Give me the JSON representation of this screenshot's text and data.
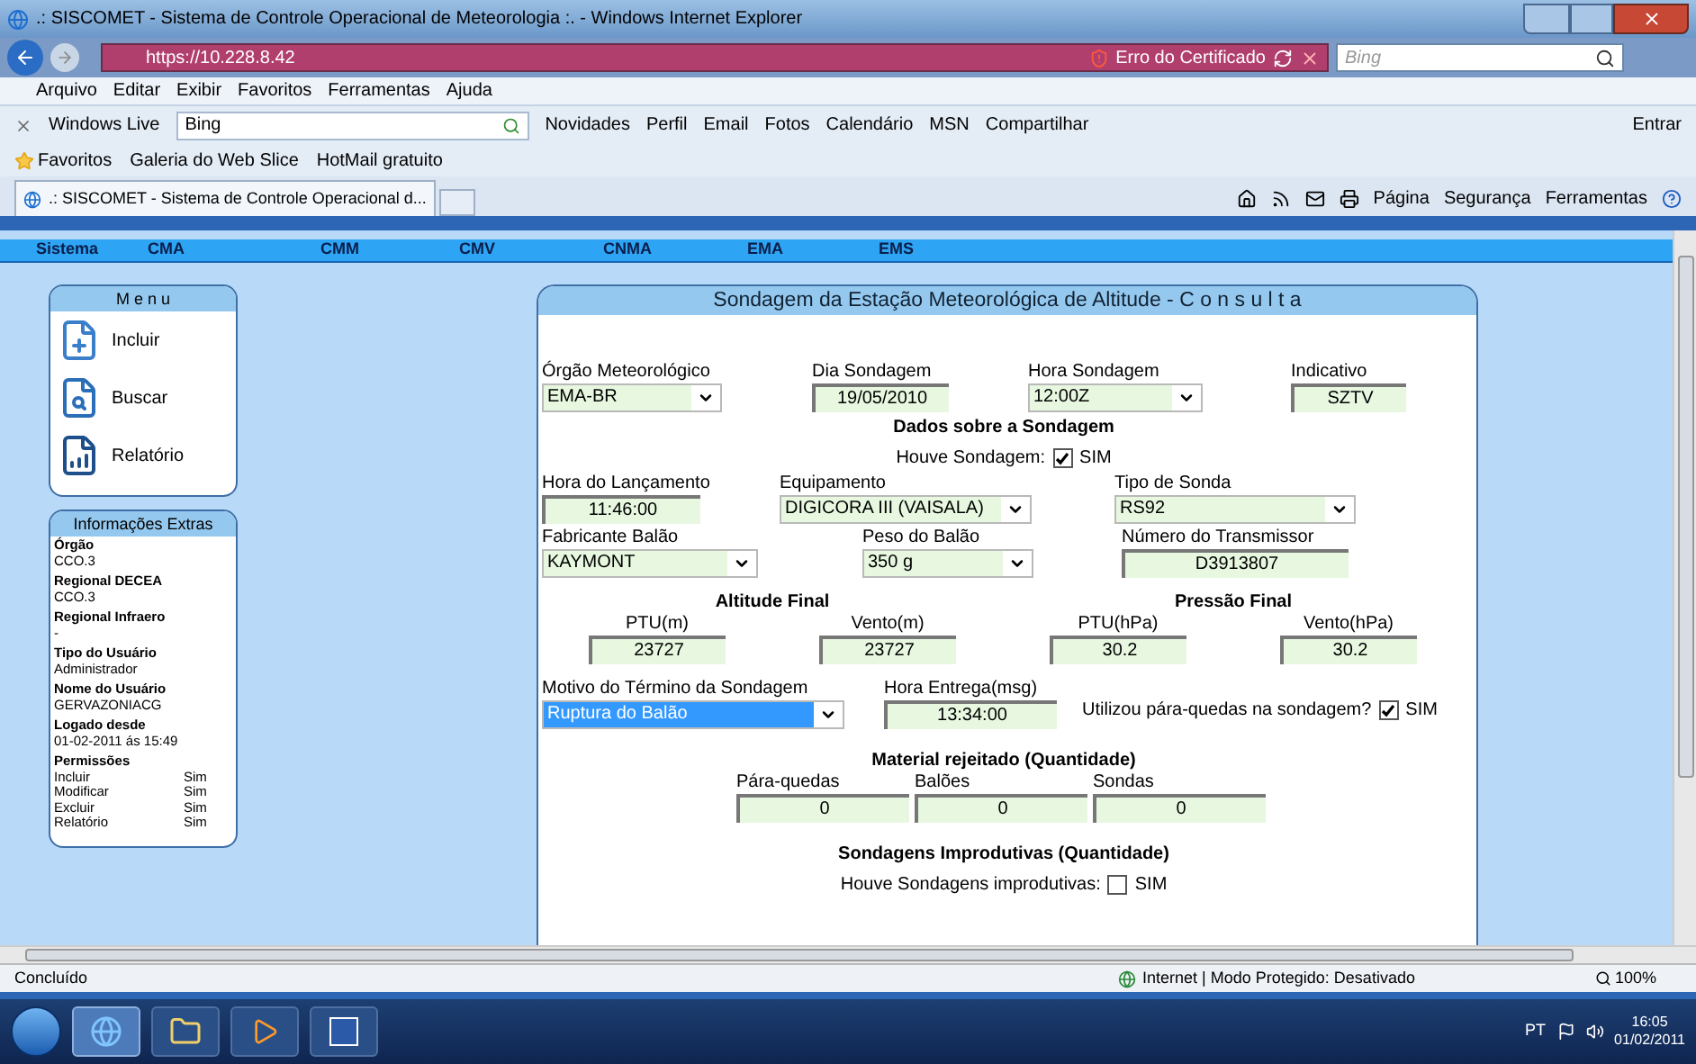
{
  "window": {
    "title": ".: SISCOMET - Sistema de Controle Operacional de Meteorologia :. - Windows Internet Explorer"
  },
  "address_bar": {
    "url": "https://10.228.8.42",
    "cert_error": "Erro do Certificado",
    "search_placeholder": "Bing"
  },
  "menu_bar": [
    "Arquivo",
    "Editar",
    "Exibir",
    "Favoritos",
    "Ferramentas",
    "Ajuda"
  ],
  "live_toolbar": {
    "brand": "Windows Live",
    "search_value": "Bing",
    "links": [
      "Novidades",
      "Perfil",
      "Email",
      "Fotos",
      "Calendário",
      "MSN",
      "Compartilhar"
    ],
    "sign_in": "Entrar"
  },
  "favorites_bar": {
    "label": "Favoritos",
    "items": [
      "Galeria do Web Slice",
      "HotMail gratuito"
    ]
  },
  "tab": {
    "title": ".: SISCOMET - Sistema de Controle Operacional d..."
  },
  "command_bar": [
    "Página",
    "Segurança",
    "Ferramentas"
  ],
  "nav": [
    "Sistema",
    "CMA",
    "CMM",
    "CMV",
    "CNMA",
    "EMA",
    "EMS"
  ],
  "menu_card": {
    "title": "M e n u",
    "items": [
      {
        "kind": "add",
        "label": "Incluir"
      },
      {
        "kind": "search",
        "label": "Buscar"
      },
      {
        "kind": "report",
        "label": "Relatório"
      }
    ]
  },
  "info_card": {
    "title": "Informações Extras",
    "entries": [
      {
        "label": "Órgão",
        "value": "CCO.3"
      },
      {
        "label": "Regional DECEA",
        "value": "CCO.3"
      },
      {
        "label": "Regional Infraero",
        "value": "-"
      },
      {
        "label": "Tipo do Usuário",
        "value": "Administrador"
      },
      {
        "label": "Nome do Usuário",
        "value": "GERVAZONIACG"
      },
      {
        "label": "Logado desde",
        "value": "01-02-2011 ás 15:49"
      }
    ],
    "permissions_label": "Permissões",
    "permissions": [
      {
        "name": "Incluir",
        "value": "Sim"
      },
      {
        "name": "Modificar",
        "value": "Sim"
      },
      {
        "name": "Excluir",
        "value": "Sim"
      },
      {
        "name": "Relatório",
        "value": "Sim"
      }
    ]
  },
  "form": {
    "title": "Sondagem da Estação Meteorológica de Altitude - C o n s u l t a",
    "row1": [
      {
        "kind": "select",
        "label": "Órgão Meteorológico",
        "value": "EMA-BR"
      },
      {
        "kind": "text",
        "label": "Dia Sondagem",
        "value": "19/05/2010"
      },
      {
        "kind": "select",
        "label": "Hora Sondagem",
        "value": "12:00Z"
      },
      {
        "kind": "text",
        "label": "Indicativo",
        "value": "SZTV"
      }
    ],
    "dados_heading": "Dados sobre a Sondagem",
    "houve_sondagem": {
      "label": "Houve Sondagem:",
      "option": "SIM",
      "checked": true
    },
    "row2": [
      {
        "kind": "text",
        "label": "Hora do Lançamento",
        "value": "11:46:00"
      },
      {
        "kind": "select",
        "label": "Equipamento",
        "value": "DIGICORA III (VAISALA)"
      },
      {
        "kind": "select",
        "label": "Tipo de Sonda",
        "value": "RS92"
      }
    ],
    "row3": [
      {
        "kind": "select",
        "label": "Fabricante Balão",
        "value": "KAYMONT"
      },
      {
        "kind": "select",
        "label": "Peso do Balão",
        "value": "350 g"
      },
      {
        "kind": "text",
        "label": "Número do Transmissor",
        "value": "D3913807"
      }
    ],
    "final_headings": [
      "Altitude Final",
      "Pressão Final"
    ],
    "finals": [
      {
        "label": "PTU(m)",
        "value": "23727"
      },
      {
        "label": "Vento(m)",
        "value": "23727"
      },
      {
        "label": "PTU(hPa)",
        "value": "30.2"
      },
      {
        "label": "Vento(hPa)",
        "value": "30.2"
      }
    ],
    "motivo": {
      "kind": "select",
      "label": "Motivo do Término da Sondagem",
      "value": "Ruptura do Balão",
      "selected": true
    },
    "hora_entrega": {
      "kind": "text",
      "label": "Hora Entrega(msg)",
      "value": "13:34:00"
    },
    "paraquedas": {
      "label": "Utilizou pára-quedas na sondagem?",
      "option": "SIM",
      "checked": true
    },
    "material_heading": "Material rejeitado (Quantidade)",
    "material": [
      {
        "label": "Pára-quedas",
        "value": "0"
      },
      {
        "label": "Balões",
        "value": "0"
      },
      {
        "label": "Sondas",
        "value": "0"
      }
    ],
    "improdutivas_heading": "Sondagens Improdutivas (Quantidade)",
    "improdutivas": {
      "label": "Houve Sondagens improdutivas:",
      "option": "SIM",
      "checked": false
    }
  },
  "status_bar": {
    "text": "Concluído",
    "zone": "Internet | Modo Protegido: Desativado",
    "zoom": "100%"
  },
  "taskbar": {
    "language": "PT",
    "time": "16:05",
    "date": "01/02/2011"
  }
}
